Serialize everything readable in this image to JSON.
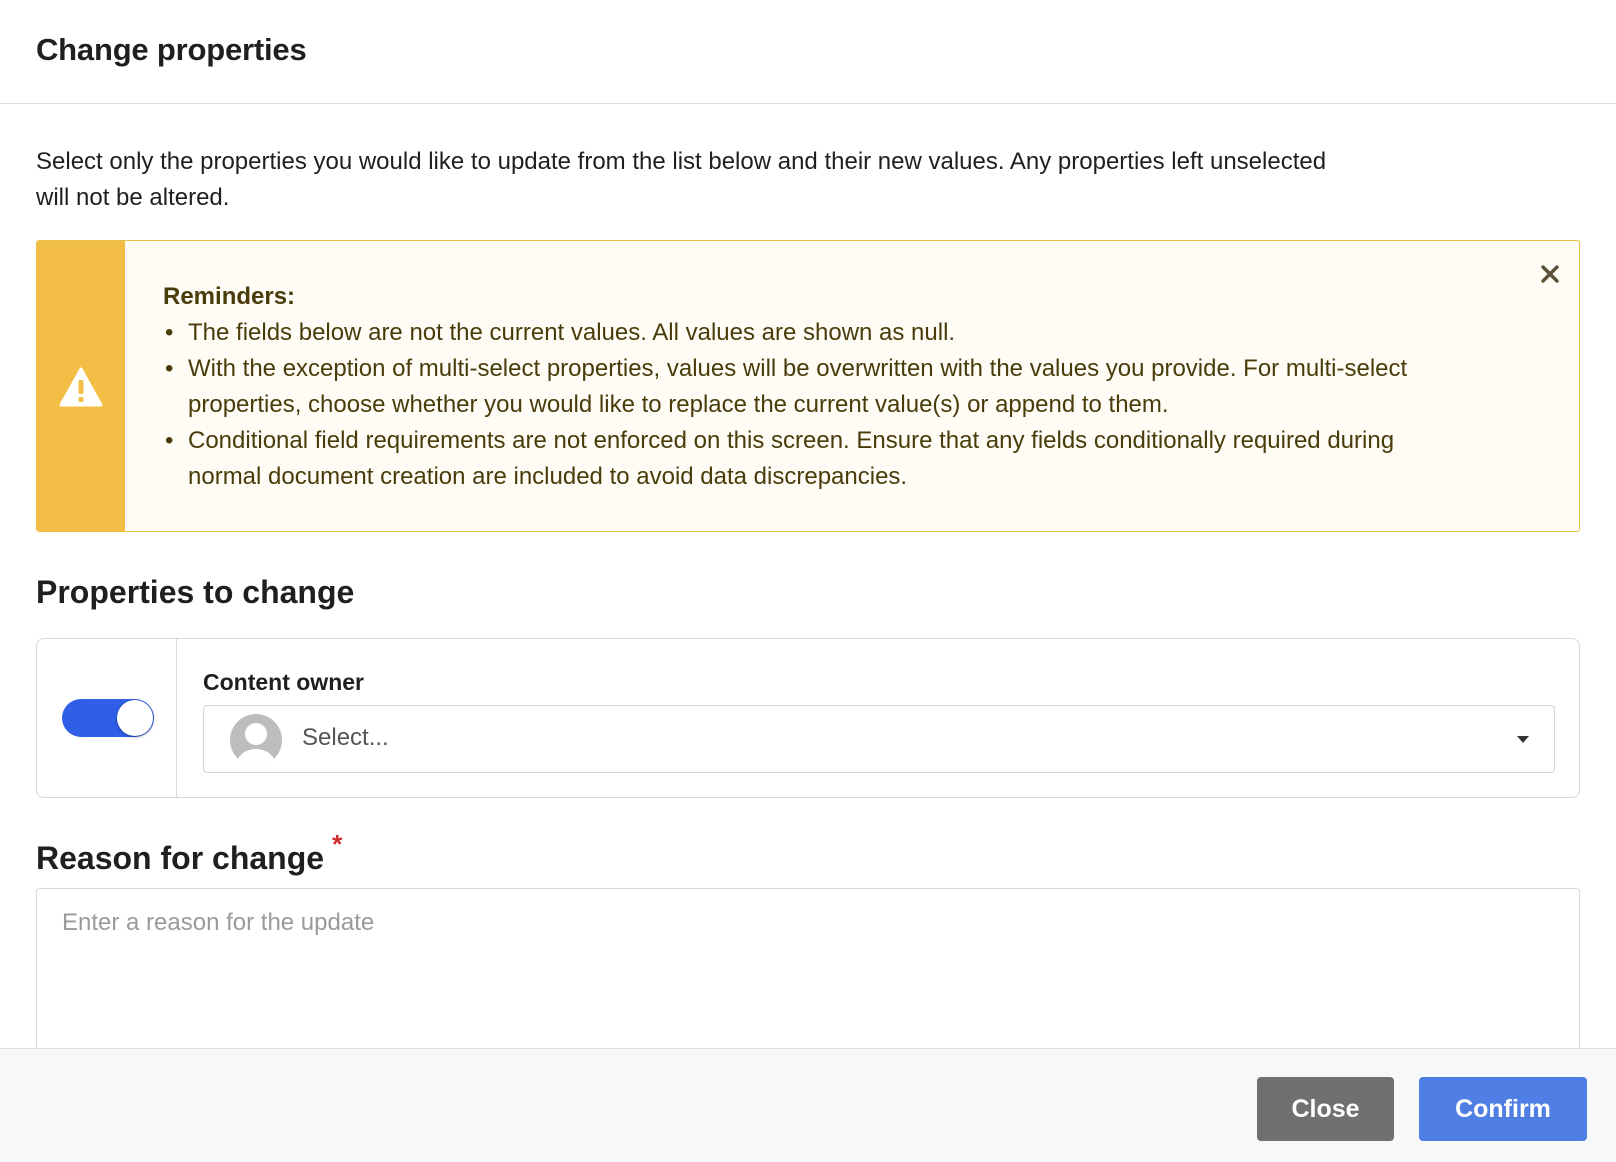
{
  "dialog": {
    "title": "Change properties",
    "intro": "Select only the properties you would like to update from the list below and their new values. Any properties left unselected will not be altered."
  },
  "reminder": {
    "title": "Reminders:",
    "items": [
      "The fields below are not the current values. All values are shown as null.",
      "With the exception of multi-select properties, values will be overwritten with the values you provide. For multi-select properties, choose whether you would like to replace the current value(s) or append to them.",
      "Conditional field requirements are not enforced on this screen. Ensure that any fields conditionally required during normal document creation are included to avoid data discrepancies."
    ],
    "icon": "warning-icon",
    "close_icon": "close-icon",
    "colors": {
      "strip": "#f2be46",
      "border": "#e8c246",
      "background": "#fefcf5",
      "text": "#4a3c0a"
    }
  },
  "properties": {
    "section_title": "Properties to change",
    "items": [
      {
        "label": "Content owner",
        "enabled": true,
        "placeholder": "Select...",
        "icon": "user-avatar-icon"
      }
    ]
  },
  "reason": {
    "section_title": "Reason for change",
    "required_marker": "*",
    "placeholder": "Enter a reason for the update",
    "value": ""
  },
  "footer": {
    "close_label": "Close",
    "confirm_label": "Confirm"
  },
  "colors": {
    "accent": "#2f5fe6",
    "confirm": "#4f7fe4",
    "close": "#707070",
    "required": "#d12a2a"
  }
}
